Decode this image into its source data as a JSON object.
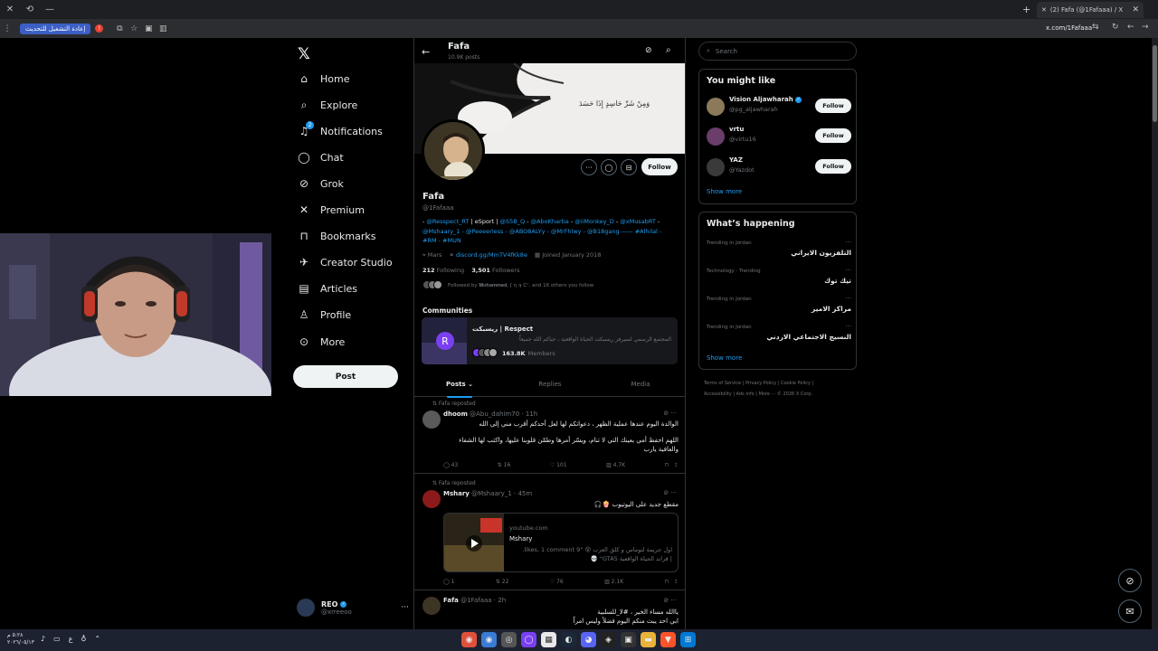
{
  "browser": {
    "tab_title": "(2) Fafa (@1Fafaaa) / X",
    "url": "x.com/1Fafaaa",
    "update_label": "إعادة التشغيل للتحديث",
    "update_badge": "!"
  },
  "nav": {
    "logo": "𝕏",
    "items": [
      {
        "label": "Home",
        "icon": "home-icon",
        "glyph": "⌂"
      },
      {
        "label": "Explore",
        "icon": "search-icon",
        "glyph": "⌕"
      },
      {
        "label": "Notifications",
        "icon": "bell-icon",
        "glyph": "🔔"
      },
      {
        "label": "Chat",
        "icon": "chat-icon",
        "glyph": "◯"
      },
      {
        "label": "Grok",
        "icon": "grok-icon",
        "glyph": "⊘"
      },
      {
        "label": "Premium",
        "icon": "premium-icon",
        "glyph": "✕"
      },
      {
        "label": "Bookmarks",
        "icon": "bookmark-icon",
        "glyph": "⊓"
      },
      {
        "label": "Creator Studio",
        "icon": "creator-studio-icon",
        "glyph": "✈"
      },
      {
        "label": "Articles",
        "icon": "articles-icon",
        "glyph": "▤"
      },
      {
        "label": "Profile",
        "icon": "profile-icon",
        "glyph": "♙"
      },
      {
        "label": "More",
        "icon": "more-icon",
        "glyph": "⊙"
      }
    ],
    "notification_badge": "2",
    "post_label": "Post",
    "me": {
      "name": "REO",
      "handle": "@xrreeoo",
      "more": "···"
    }
  },
  "profile": {
    "name": "Fafa",
    "posts_count": "10.9K posts",
    "handle": "@1Fafaaa",
    "follow_label": "Follow",
    "banner_text": "وَمِنْ شَرِّ حَاسِدٍ إِذَا حَسَدَ",
    "bio_line1_pre": "- ",
    "bio_line1_a": "@Resspect_RT",
    "bio_line1_b": " | eSport | ",
    "bio_line1_c": "@S5B_Q",
    "bio_line1_d": " - ",
    "bio_line1_e": "@AboKharba",
    "bio_line1_f": " - ",
    "bio_line1_g": "@iiMonkey_D",
    "bio_line1_h": " - ",
    "bio_line1_i": "@xMusabRT",
    "bio_line1_j": " -",
    "bio_line2": "@Mshaary_1 - @Peeeerless - @ABO8ALYy - @MrFhlwy - @B18gang —— #Alhilal -",
    "bio_line3": "#RM - #MUN",
    "location": "Mars",
    "website": "discord.gg/MmTV4fKk8e",
    "joined": "Joined January 2018",
    "following_count": "212",
    "following_label": "Following",
    "followers_count": "3,501",
    "followers_label": "Followers",
    "followed_by": "Followed by 𝐌𝐨𝐡𝐚𝐦𝐦𝐞𝐝, ʃ ɳ ʞ ᑕᐟ, and 16 others you follow"
  },
  "communities": {
    "heading": "Communities",
    "name": "ريسبكت | Respect",
    "desc": "المجتمع الرسمي لسيرفر ريسبكت الحياة الواقعية ، حياكم الله جميعاً",
    "members_count": "163.8K",
    "members_label": "Members"
  },
  "tabs": [
    {
      "label": "Posts ⌄",
      "active": true
    },
    {
      "label": "Replies",
      "active": false
    },
    {
      "label": "Media",
      "active": false
    }
  ],
  "tweets": [
    {
      "repost_label": "⇅ Fafa reposted",
      "name": "dhoom",
      "meta": "@Abu_dahim70 · 11h",
      "line1": "الوالدة اليوم عندها عملية الظهر ، دعواتكم لها لعل أحدكم أقرب مني إلى الله",
      "line2": "اللهم احفظ أمي بعينك التي لا تنام، ويسّر أمرها وطمّن قلوبنا عليها، واكتب لها الشفاء",
      "line3": "والعافية يارب",
      "replies": "43",
      "reposts": "16",
      "likes": "101",
      "views": "4.7K"
    },
    {
      "repost_label": "⇅ Fafa reposted",
      "name": "Mshary",
      "meta": "@Mshaary_1 · 45m",
      "line1": "مقطع جديد على اليوتيوب 🍿🎧",
      "yt_domain": "youtube.com",
      "yt_title": "Mshary",
      "yt_desc1": "اول جريمة لتوماس و كلق العزب 😵 \"9 likes, 1 comment.",
      "yt_desc2": "| قراند الحياة الواقعية GTA5\" 💀",
      "replies": "1",
      "reposts": "22",
      "likes": "76",
      "views": "2.1K"
    },
    {
      "name": "Fafa",
      "meta": "@1Fafaaa · 2h",
      "line1": "ياالله مساء الخير ، #لا_للسلبية",
      "line2": "ابي احد يبث منكم اليوم فضلاً وليس امراً"
    }
  ],
  "right": {
    "search_placeholder": "Search",
    "you_might_like": "You might like",
    "suggestions": [
      {
        "name": "Vision Aljawharah",
        "handle": "@pg_aljawharah",
        "verified": true
      },
      {
        "name": "vrtu",
        "handle": "@virtu16",
        "verified": false
      },
      {
        "name": "YAZ",
        "handle": "@Yazdot",
        "verified": false
      }
    ],
    "follow_label": "Follow",
    "show_more": "Show more",
    "happening": "What’s happening",
    "trends": [
      {
        "context": "Trending in Jordan",
        "title": "التلفزيون الايراني"
      },
      {
        "context": "Technology · Trending",
        "title": "تيك توك"
      },
      {
        "context": "Trending in Jordan",
        "title": "مراكز الامير"
      },
      {
        "context": "Trending in Jordan",
        "title": "النسيج الاجتماعي الاردني"
      }
    ],
    "footer_line1": "Terms of Service  |  Privacy Policy  |  Cookie Policy  |",
    "footer_line2": "Accessibility  |  Ads info  |  More ···  © 2026 X Corp."
  },
  "taskbar": {
    "time": "٥:٢٨ م",
    "date": "٢٠٢٦/٠٥/١٣",
    "lang": "ع"
  }
}
